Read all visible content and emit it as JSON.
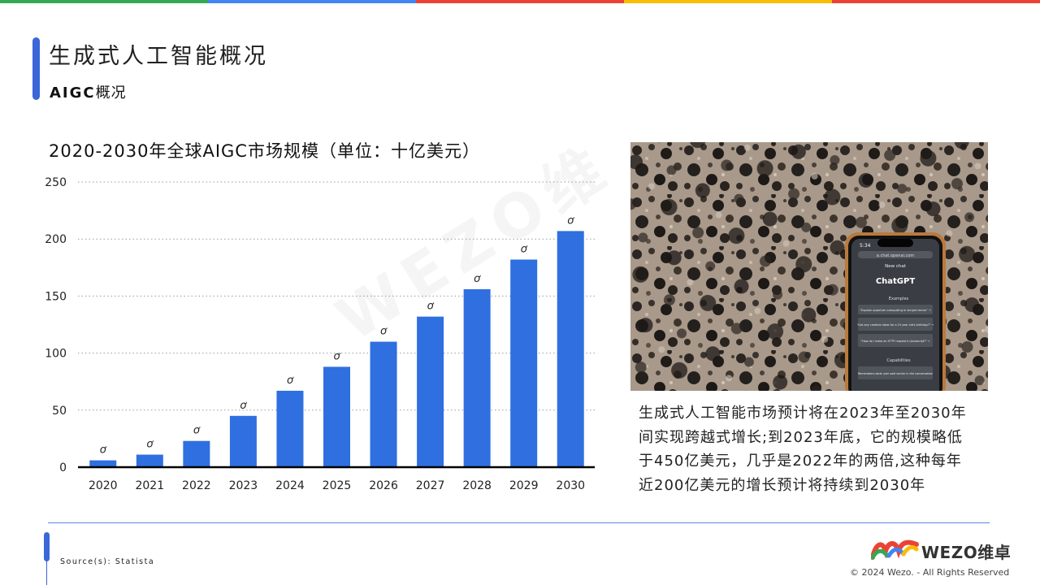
{
  "header": {
    "title": "生成式人工智能概况",
    "subtitle_bold": "AIGC",
    "subtitle_rest": "概况"
  },
  "top_bar_colors": [
    "#34a853",
    "#4285f4",
    "#ea4335",
    "#fbbc05",
    "#ea4335"
  ],
  "chart_data": {
    "type": "bar",
    "title": "2020-2030年全球AIGC市场规模（单位：十亿美元）",
    "categories": [
      "2020",
      "2021",
      "2022",
      "2023",
      "2024",
      "2025",
      "2026",
      "2027",
      "2028",
      "2029",
      "2030"
    ],
    "values": [
      6,
      11,
      23,
      45,
      67,
      88,
      110,
      132,
      156,
      182,
      207
    ],
    "value_marker": "ơ",
    "ylim": [
      0,
      250
    ],
    "yticks": [
      "0",
      "50",
      "100",
      "150",
      "200",
      "250"
    ],
    "xlabel": "",
    "ylabel": "",
    "grid": true,
    "bar_color": "#2f6fe0"
  },
  "watermark": "WEZO维",
  "photo": {
    "phone_time": "5:34",
    "url": "a.chat.openai.com",
    "new_chat": "New chat",
    "app_name": "ChatGPT",
    "examples_label": "Examples",
    "examples": [
      "\"Explain quantum computing in simple terms\" →",
      "\"Got any creative ideas for a 10 year old's birthday?\" →",
      "\"How do I make an HTTP request in Javascript?\" →"
    ],
    "capabilities_label": "Capabilities",
    "capability": "Remembers what user said earlier in the conversation"
  },
  "caption": {
    "lines": [
      "生成式人工智能市场预计将在2023年至2030年",
      "间实现跨越式增长;到2023年底，它的规模略低",
      "于450亿美元，几乎是2022年的两倍,这种每年",
      "近200亿美元的增长预计将持续到2030年"
    ]
  },
  "footer": {
    "source": "Source(s): Statista",
    "logo_text": "WEZO维卓",
    "copyright": "© 2024 Wezo. - All Rights Reserved"
  }
}
